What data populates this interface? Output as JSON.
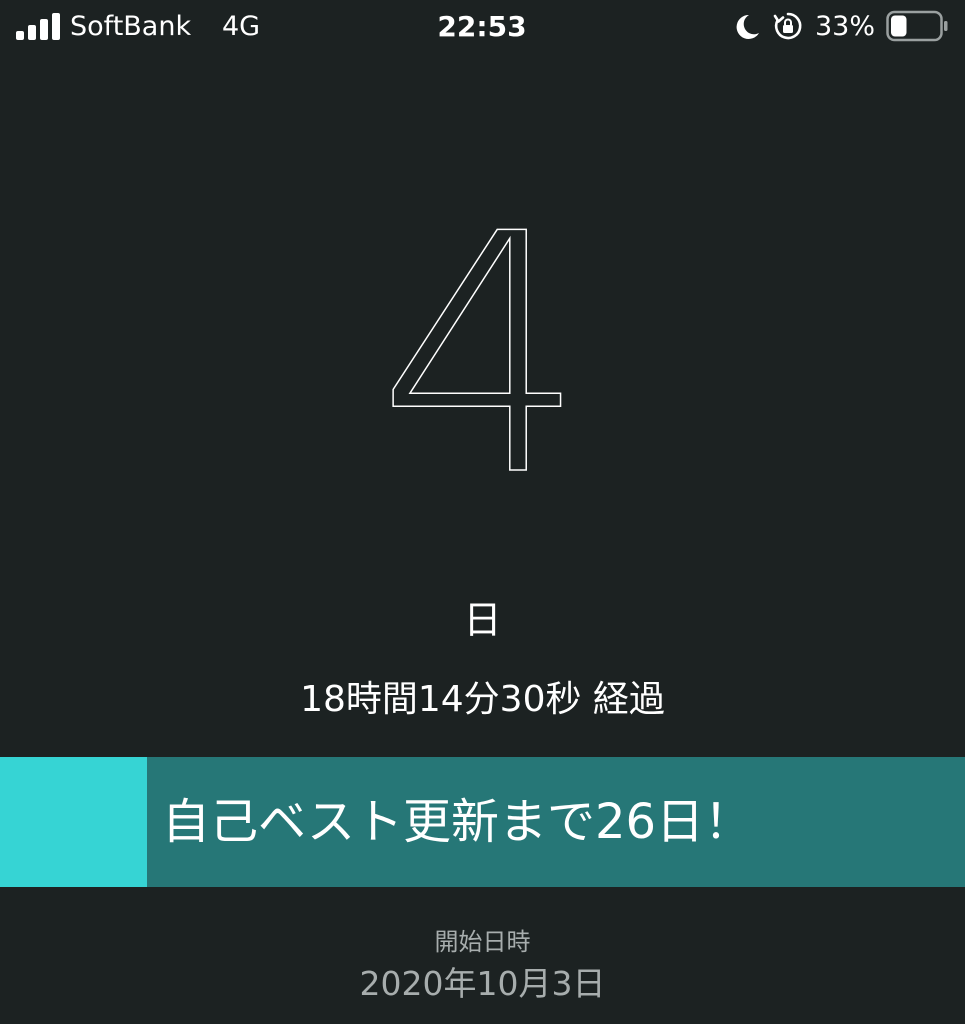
{
  "status_bar": {
    "carrier": "SoftBank",
    "network": "4G",
    "time": "22:53",
    "battery_percent_label": "33%",
    "battery_level": 0.33,
    "signal_bars": 4,
    "icons": [
      "signal-icon",
      "moon-icon",
      "orientation-lock-icon",
      "battery-icon"
    ]
  },
  "counter": {
    "days": "4",
    "days_unit": "日",
    "elapsed_detail": "18時間14分30秒 経過"
  },
  "progress": {
    "message": "自己ベスト更新まで26日！",
    "fraction": 0.152,
    "fill_color": "#36d4d4",
    "track_color": "#267777"
  },
  "start": {
    "label": "開始日時",
    "date": "2020年10月3日"
  },
  "colors": {
    "background": "#1c2222",
    "text": "#ffffff",
    "muted_text": "#a7adad"
  }
}
